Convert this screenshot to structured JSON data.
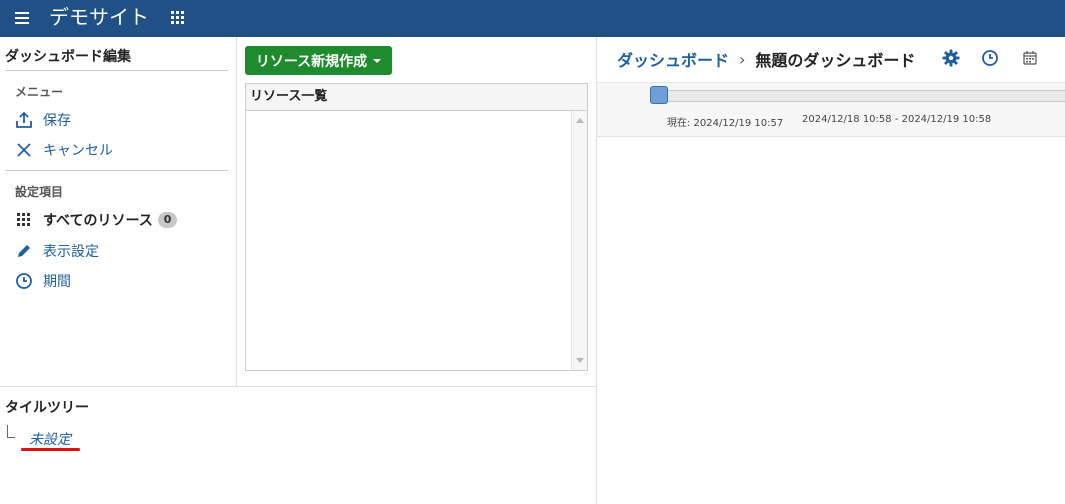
{
  "header": {
    "title": "デモサイト"
  },
  "left_panel": {
    "title": "ダッシュボード編集",
    "menu_section": "メニュー",
    "save_label": "保存",
    "cancel_label": "キャンセル",
    "settings_section": "設定項目",
    "all_resources_label": "すべてのリソース",
    "all_resources_count": "0",
    "display_settings_label": "表示設定",
    "period_label": "期間"
  },
  "middle_panel": {
    "new_resource_button": "リソース新規作成",
    "resource_list_header": "リソース一覧"
  },
  "tile_tree": {
    "title": "タイルツリー",
    "node_label": "未設定"
  },
  "right_panel": {
    "breadcrumb_link": "ダッシュボード",
    "breadcrumb_sep": "›",
    "breadcrumb_current": "無題のダッシュボード",
    "current_time_label": "現在: 2024/12/19 10:57",
    "range_label": "2024/12/18 10:58 - 2024/12/19 10:58"
  },
  "colors": {
    "header_bg": "#1f5086",
    "link": "#1f5f9e",
    "primary_button": "#1d8b2e",
    "highlight_underline": "#dd1111"
  },
  "icons": [
    "menu-icon",
    "apps-icon",
    "upload-icon",
    "close-icon",
    "grid-icon",
    "pencil-icon",
    "clock-icon",
    "gear-icon",
    "calendar-icon"
  ]
}
